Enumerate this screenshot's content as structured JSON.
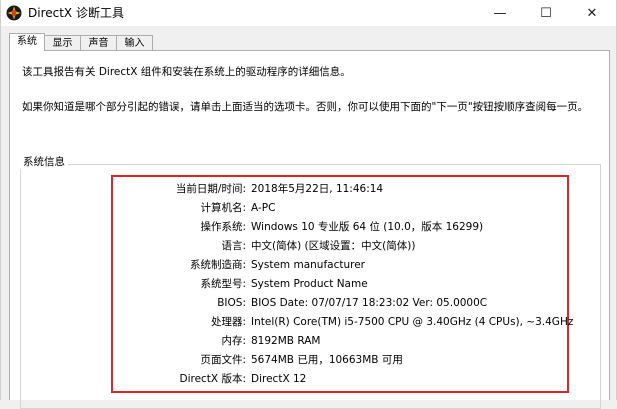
{
  "window": {
    "title": "DirectX 诊断工具",
    "minimize_glyph": "—",
    "maximize_glyph": "☐",
    "close_glyph": "✕"
  },
  "tabs": [
    {
      "label": "系统",
      "active": true
    },
    {
      "label": "显示",
      "active": false
    },
    {
      "label": "声音",
      "active": false
    },
    {
      "label": "输入",
      "active": false
    }
  ],
  "intro": {
    "line1": "该工具报告有关 DirectX 组件和安装在系统上的驱动程序的详细信息。",
    "line2": "如果你知道是哪个部分引起的错误，请单击上面适当的选项卡。否则，你可以使用下面的\"下一页\"按钮按顺序查阅每一页。"
  },
  "system_info": {
    "group_label": "系统信息",
    "rows": [
      {
        "label": "当前日期/时间:",
        "value": "2018年5月22日, 11:46:14"
      },
      {
        "label": "计算机名:",
        "value": "A-PC"
      },
      {
        "label": "操作系统:",
        "value": "Windows 10 专业版 64 位 (10.0，版本 16299)"
      },
      {
        "label": "语言:",
        "value": "中文(简体) (区域设置：中文(简体))"
      },
      {
        "label": "系统制造商:",
        "value": "System manufacturer"
      },
      {
        "label": "系统型号:",
        "value": "System Product Name"
      },
      {
        "label": "BIOS:",
        "value": "BIOS Date: 07/07/17 18:23:02 Ver: 05.0000C"
      },
      {
        "label": "处理器:",
        "value": "Intel(R) Core(TM) i5-7500 CPU @ 3.40GHz (4 CPUs), ~3.4GHz"
      },
      {
        "label": "内存:",
        "value": "8192MB RAM"
      },
      {
        "label": "页面文件:",
        "value": "5674MB 已用，10663MB 可用"
      },
      {
        "label": "DirectX 版本:",
        "value": "DirectX 12"
      }
    ]
  },
  "colors": {
    "highlight_border": "#d8262c",
    "tab_border": "#adadad",
    "window_bg": "#f0f0f0"
  }
}
